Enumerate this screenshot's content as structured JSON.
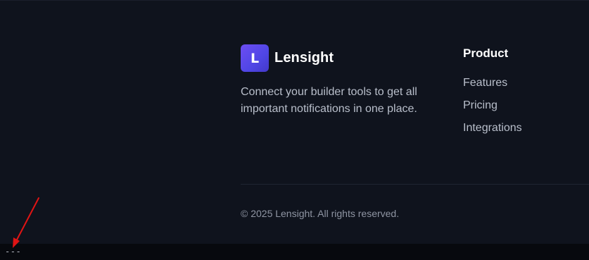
{
  "brand": {
    "logo_letter": "L",
    "name": "Lensight",
    "accent": "#4f46e5"
  },
  "footer": {
    "tagline": "Connect your builder tools to get all important notifications in one place.",
    "product_column": {
      "title": "Product",
      "links": [
        "Features",
        "Pricing",
        "Integrations"
      ]
    },
    "copyright": "© 2025 Lensight. All rights reserved."
  },
  "console": {
    "text": "---"
  },
  "annotation": {
    "icon": "red-arrow-icon",
    "color": "#e01414"
  }
}
